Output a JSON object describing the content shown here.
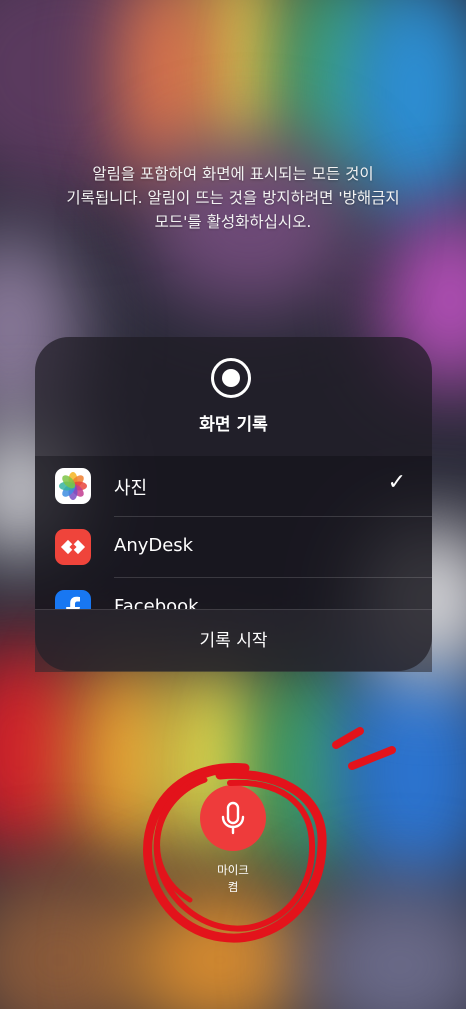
{
  "notice": {
    "line1": "알림을 포함하여 화면에 표시되는 모든 것이",
    "line2": "기록됩니다. 알림이 뜨는 것을 방지하려면 '방해금지",
    "line3": "모드'를 활성화하십시오."
  },
  "panel": {
    "record_icon": "screen-record-icon",
    "title": "화면 기록",
    "apps": [
      {
        "label": "사진",
        "icon": "photos-icon",
        "selected": true
      },
      {
        "label": "AnyDesk",
        "icon": "anydesk-icon",
        "selected": false
      },
      {
        "label": "Facebook",
        "icon": "facebook-icon",
        "selected": false
      }
    ],
    "check_glyph": "✓",
    "start_label": "기록 시작"
  },
  "mic": {
    "icon": "microphone-icon",
    "label_line1": "마이크",
    "label_line2": "켬",
    "color": "#ee3b3b"
  },
  "annotation_color": "#e3131b"
}
